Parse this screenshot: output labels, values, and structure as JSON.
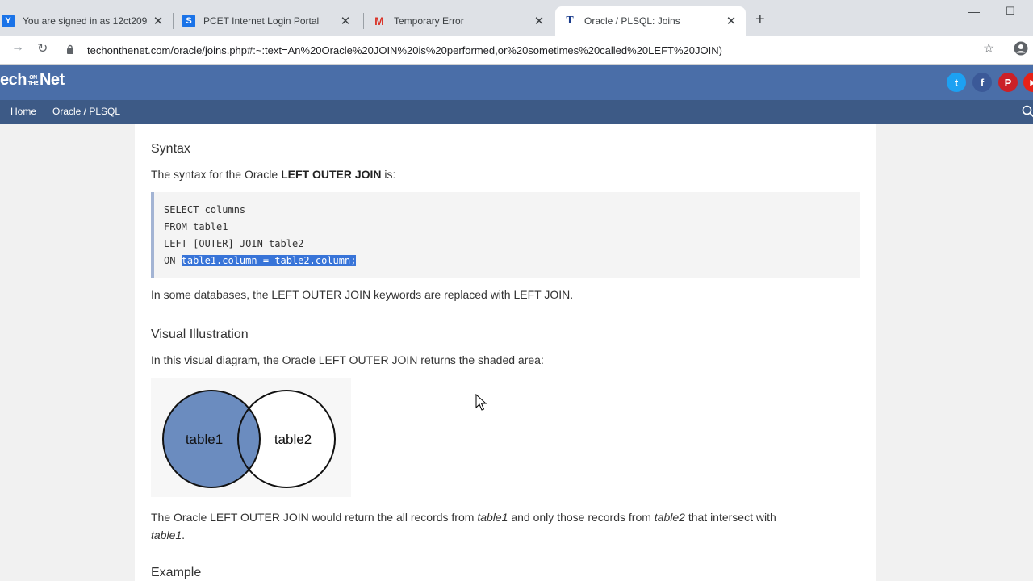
{
  "browser": {
    "tabs": [
      {
        "title": "You are signed in as 12ct209",
        "favicon": "Y",
        "favicon_color": "#1a73e8"
      },
      {
        "title": "PCET Internet Login Portal",
        "favicon": "S",
        "favicon_color": "#1a73e8"
      },
      {
        "title": "Temporary Error",
        "favicon": "M",
        "favicon_color": "#d93025"
      },
      {
        "title": "Oracle / PLSQL: Joins",
        "favicon": "T",
        "favicon_color": "#1a3c8c"
      }
    ],
    "url": "techonthenet.com/oracle/joins.php#:~:text=An%20Oracle%20JOIN%20is%20performed,or%20sometimes%20called%20LEFT%20JOIN)"
  },
  "site": {
    "logo": {
      "left": "ech",
      "small": "ON THE",
      "right": "Net"
    },
    "nav": [
      {
        "label": "Home"
      },
      {
        "label": "Oracle / PLSQL"
      }
    ],
    "social": [
      {
        "icon": "twitter-icon",
        "glyph": "t",
        "color": "#1da1f2"
      },
      {
        "icon": "facebook-icon",
        "glyph": "f",
        "color": "#3b5998"
      },
      {
        "icon": "pinterest-icon",
        "glyph": "P",
        "color": "#cb2027"
      },
      {
        "icon": "youtube-icon",
        "glyph": "▶",
        "color": "#e62117"
      }
    ]
  },
  "article": {
    "syntax_heading": "Syntax",
    "syntax_intro_pre": "The syntax for the Oracle ",
    "syntax_intro_bold": "LEFT OUTER JOIN",
    "syntax_intro_post": " is:",
    "code": [
      {
        "prefix": "SELECT columns",
        "selected": ""
      },
      {
        "prefix": "FROM table1",
        "selected": ""
      },
      {
        "prefix": "LEFT [OUTER] JOIN table2",
        "selected": ""
      },
      {
        "prefix": "ON ",
        "selected": "table1.column = table2.column;"
      }
    ],
    "note": "In some databases, the LEFT OUTER JOIN keywords are replaced with LEFT JOIN.",
    "visual_heading": "Visual Illustration",
    "visual_intro": "In this visual diagram, the Oracle LEFT OUTER JOIN returns the shaded area:",
    "venn": {
      "left_label": "table1",
      "right_label": "table2",
      "shade_color": "#6b8cbf"
    },
    "result_pre": "The Oracle LEFT OUTER JOIN would return the all records from ",
    "result_em1": "table1",
    "result_mid": " and only those records from ",
    "result_em2": "table2",
    "result_post": " that intersect with",
    "result_em3": "table1",
    "result_end": ".",
    "example_heading": "Example"
  }
}
